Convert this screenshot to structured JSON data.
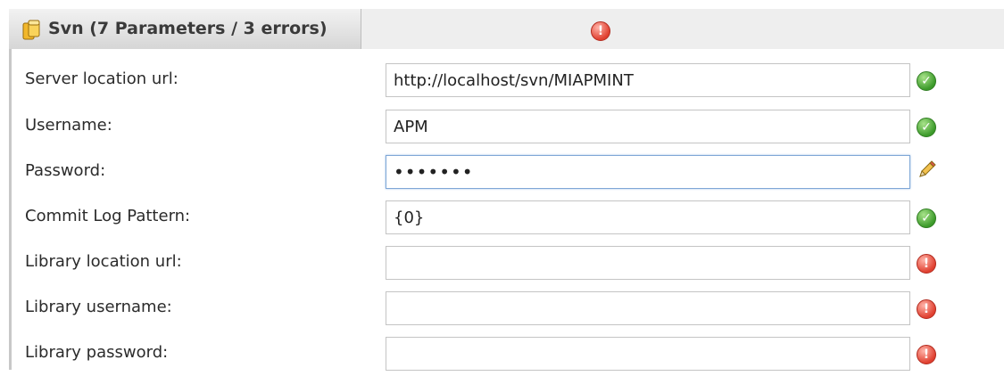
{
  "panel": {
    "title": "Svn (7 Parameters / 3 errors)",
    "header_status_icon": "error-icon"
  },
  "rows": [
    {
      "label": "Server location url:",
      "value": "http://localhost/svn/MIAPMINT",
      "status": "ok"
    },
    {
      "label": "Username:",
      "value": "APM",
      "status": "ok"
    },
    {
      "label": "Password:",
      "value": "•••••••",
      "status": "editing"
    },
    {
      "label": "Commit Log Pattern:",
      "value": "{0}",
      "status": "ok"
    },
    {
      "label": "Library location url:",
      "value": "",
      "status": "error"
    },
    {
      "label": "Library username:",
      "value": "",
      "status": "error"
    },
    {
      "label": "Library password:",
      "value": "",
      "status": "error"
    }
  ],
  "colors": {
    "ok": "#3c9a2a",
    "error": "#e04030",
    "header_bg": "#eeeeee",
    "focus_border": "#7fa7d6"
  }
}
